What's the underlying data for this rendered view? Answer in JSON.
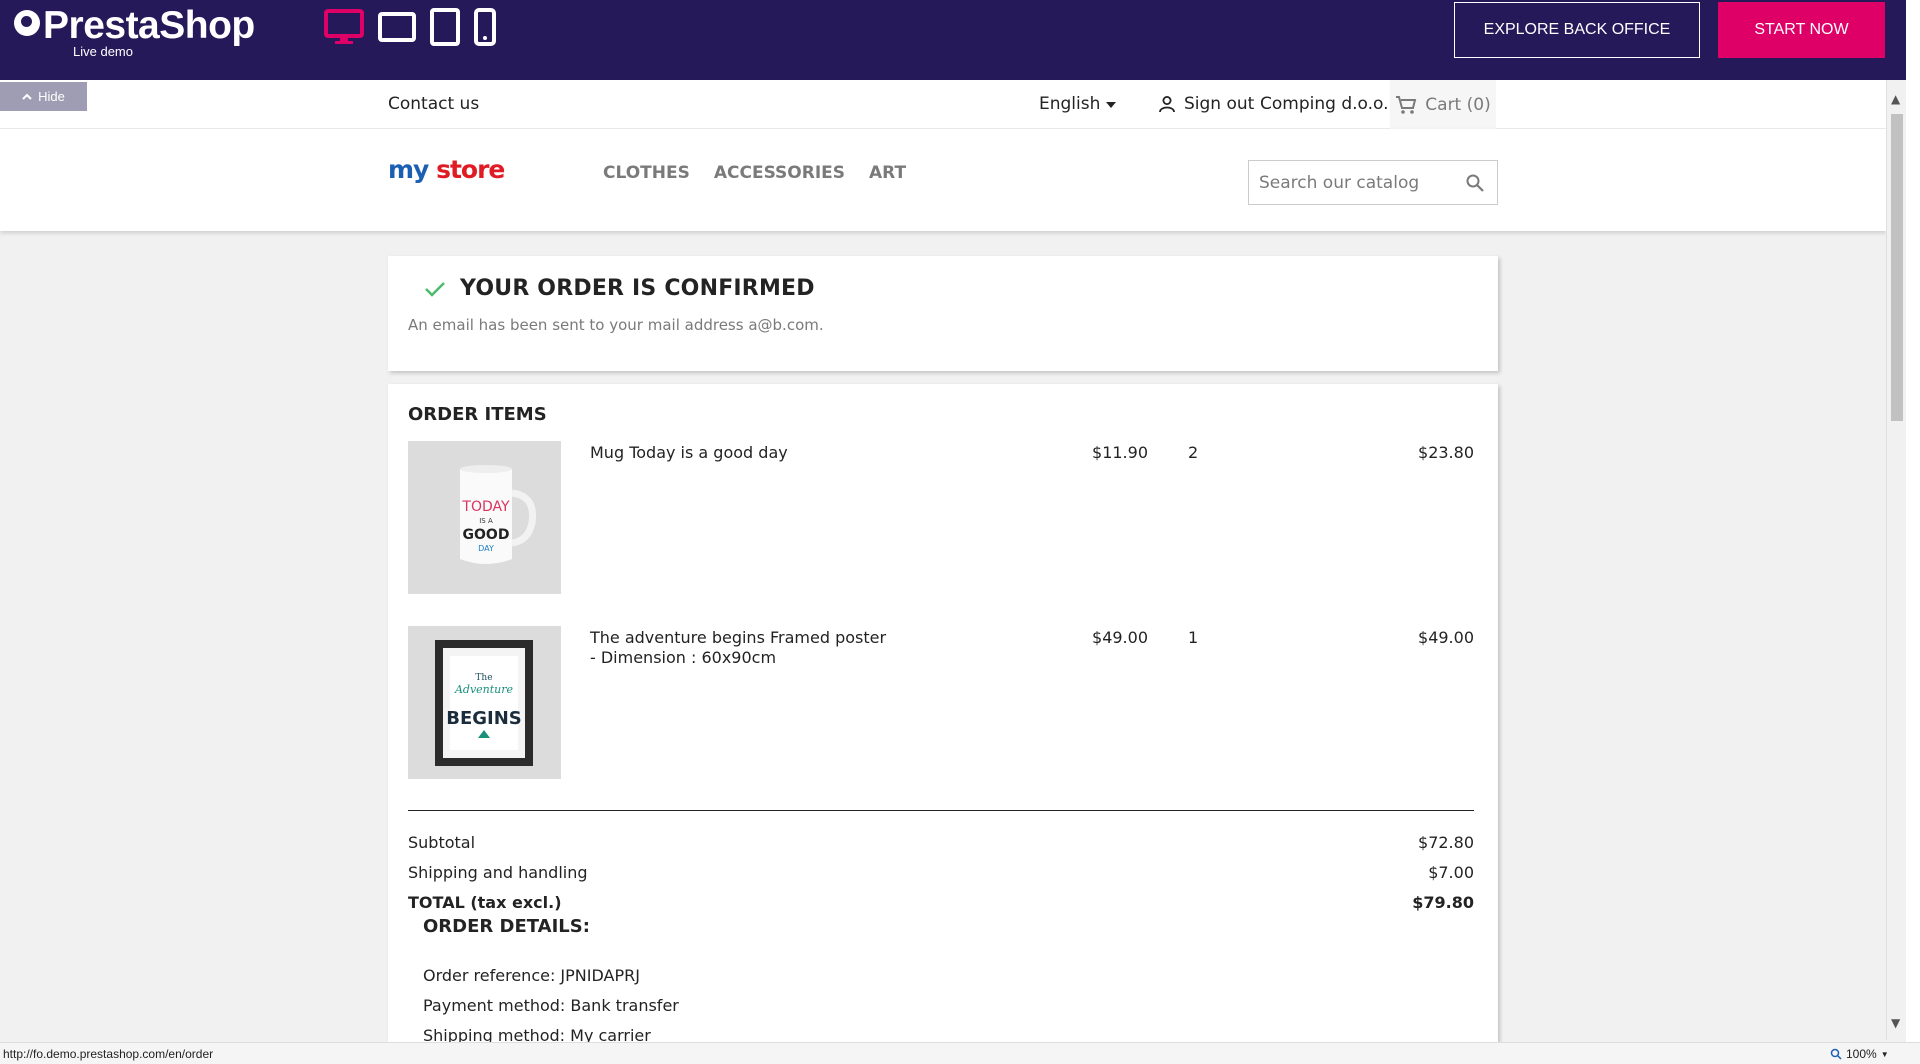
{
  "demo_bar": {
    "logo_title": "PrestaShop",
    "logo_sub": "Live demo",
    "explore_label": "EXPLORE BACK OFFICE",
    "start_label": "START NOW",
    "accent_color": "#df0067",
    "bar_color": "#25195a"
  },
  "hide_tab": {
    "label": "Hide"
  },
  "nav": {
    "contact": "Contact us",
    "language": "English",
    "signout": "Sign out",
    "account": "Comping d.o.o.",
    "cart": "Cart (0)"
  },
  "header": {
    "logo_my": "my",
    "logo_store": "store",
    "menu": [
      "CLOTHES",
      "ACCESSORIES",
      "ART"
    ],
    "search_placeholder": "Search our catalog"
  },
  "confirmation": {
    "title": "YOUR ORDER IS CONFIRMED",
    "subtitle": "An email has been sent to your mail address a@b.com."
  },
  "order_items": {
    "title": "ORDER ITEMS",
    "items": [
      {
        "name": "Mug Today is a good day",
        "price": "$11.90",
        "qty": "2",
        "total": "$23.80",
        "image": "mug-image",
        "image_lines": [
          "TODAY",
          "IS A",
          "GOOD",
          "DAY"
        ]
      },
      {
        "name": "The adventure begins Framed poster - Dimension : 60x90cm",
        "price": "$49.00",
        "qty": "1",
        "total": "$49.00",
        "image": "framed-poster-image",
        "image_lines": [
          "The",
          "Adventure",
          "BEGINS"
        ]
      }
    ]
  },
  "summary": {
    "subtotal_label": "Subtotal",
    "subtotal": "$72.80",
    "shipping_label": "Shipping and handling",
    "shipping": "$7.00",
    "total_label": "TOTAL (tax excl.)",
    "total": "$79.80"
  },
  "details": {
    "title": "ORDER DETAILS:",
    "reference": "Order reference: JPNIDAPRJ",
    "payment": "Payment method: Bank transfer",
    "shipping": "Shipping method: My carrier"
  },
  "status_bar": {
    "url": "http://fo.demo.prestashop.com/en/order",
    "zoom": "100%"
  }
}
